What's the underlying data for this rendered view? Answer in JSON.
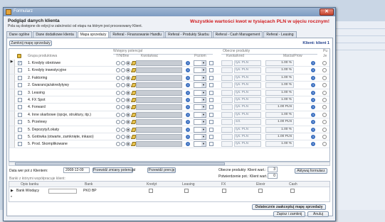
{
  "form": {
    "title": "Formularz",
    "header_title": "Podgląd danych klienta",
    "header_subtitle": "Pola są dostępne do edycji w zależności od etapu na którym jest procesowany Klient.",
    "warning": "Wszystkie wartości kwot w tysiącach PLN w ujęciu rocznym!"
  },
  "tabs": [
    {
      "label": "Dane ogólne"
    },
    {
      "label": "Dane dodatkowe klienta"
    },
    {
      "label": "Mapa sprzedaży"
    },
    {
      "label": "Referal - Finansowanie Handlu"
    },
    {
      "label": "Referal - Produkty Skarbu"
    },
    {
      "label": "Referal - Cash Management"
    },
    {
      "label": "Referal - Leasing"
    }
  ],
  "toolbar": {
    "save_map_label": "Zamknij mapę sprzedaży",
    "client_label": "Klient: klient 1"
  },
  "grid": {
    "col_group": "Grupa produktowa",
    "col_wstepny": "Wstępny potencjał",
    "col_tnbrw": "T/N/Brw",
    "col_kwota": "Kwota/wac",
    "col_poziom": "Poziom",
    "col_obecne": "Obecne produkty",
    "col_kwota_kredyt": "Kwota/kred",
    "col_marza": "Marża/Prow",
    "col_pu": "Pu",
    "col_je": "Je",
    "rows": [
      {
        "name": "1. Kredyty obrotowe",
        "checked": "✓",
        "unit": "tys. PLN",
        "pct": "1.00 %"
      },
      {
        "name": "1. Kredyty inwestycyjne",
        "checked": "",
        "unit": "tys. PLN",
        "pct": "1.00 %"
      },
      {
        "name": "2. Faktoring",
        "checked": "",
        "unit": "tys. PLN",
        "pct": "1.00 %"
      },
      {
        "name": "2. Gwarancja/akredytywy",
        "checked": "",
        "unit": "tys. PLN",
        "pct": "1.00 %"
      },
      {
        "name": "3. Leasing",
        "checked": "",
        "unit": "tys. PLN",
        "pct": "1.00 %"
      },
      {
        "name": "4. FX Spot",
        "checked": "",
        "unit": "tys. PLN",
        "pct": "1.00 %"
      },
      {
        "name": "4. Forward",
        "checked": "",
        "unit": "tys. PLN",
        "pct": "1.00 PLN"
      },
      {
        "name": "4. Inne skarbowe (opcje, struktury, itp.)",
        "checked": "",
        "unit": "tys. PLN",
        "pct": "1.00 %"
      },
      {
        "name": "5. Przelewy",
        "checked": "",
        "unit": "szt.",
        "pct": "1.00 PLN"
      },
      {
        "name": "5. Depozyty/Lokaty",
        "checked": "",
        "unit": "tys. PLN",
        "pct": "1.00 %"
      },
      {
        "name": "5. Gotówka (otwarte, zamknięte, inkaso)",
        "checked": "",
        "unit": "tys. PLN",
        "pct": "1.00 PLN"
      },
      {
        "name": "5. Prod. Skomplikowane",
        "checked": "",
        "unit": "tys. PLN",
        "pct": "1.00 %"
      }
    ]
  },
  "bottom": {
    "date_label": "Data wer pot z Klientem:",
    "date_value": "2008-12-09",
    "btn_przewid": "Przewidź zmiany potencjał",
    "btn_przewid2": "Przewidź prercję",
    "obecne_label": "Obecne produkty: Klient wart.:",
    "obecne_value": "3",
    "potw_label": "Potwierdzenie pot.: Klient wart.:",
    "potw_value": "0",
    "btn_aktywuj": "Aktywuj formularz",
    "banks_title": "Banki z którymi współpracuje klient:",
    "bank_cols": [
      "Opis banku",
      "Bank",
      "Kredyt",
      "Leasing",
      "FX",
      "Elexir",
      "Cash"
    ],
    "bank_row": {
      "opis": "Bank Wiodący",
      "bank": "PKO BP"
    },
    "btn_zaakceptuj": "Ostatecznie zaakceptuj mapę sprzedaży",
    "btn_zapisz": "Zapisz i zamknij",
    "btn_anuluj": "Anuluj"
  }
}
